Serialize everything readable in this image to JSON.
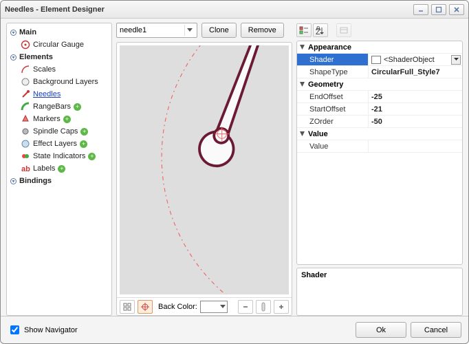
{
  "window": {
    "title": "Needles - Element Designer"
  },
  "sidebar": {
    "groups": [
      {
        "label": "Main"
      },
      {
        "label": "Elements"
      },
      {
        "label": "Bindings"
      }
    ],
    "main_items": [
      {
        "label": "Circular Gauge"
      }
    ],
    "elements_items": [
      {
        "label": "Scales"
      },
      {
        "label": "Background Layers"
      },
      {
        "label": "Needles"
      },
      {
        "label": "RangeBars"
      },
      {
        "label": "Markers"
      },
      {
        "label": "Spindle Caps"
      },
      {
        "label": "Effect Layers"
      },
      {
        "label": "State Indicators"
      },
      {
        "label": "Labels"
      }
    ]
  },
  "center": {
    "selected_needle": "needle1",
    "clone_label": "Clone",
    "remove_label": "Remove",
    "backcolor_label": "Back Color:",
    "backcolor_value": "#FFFFFF"
  },
  "propgrid": {
    "categories": [
      {
        "name": "Appearance",
        "props": [
          {
            "name": "Shader",
            "value": "<ShaderObject",
            "selected": true,
            "swatch": true,
            "dropdown": true
          },
          {
            "name": "ShapeType",
            "value": "CircularFull_Style7"
          }
        ]
      },
      {
        "name": "Geometry",
        "props": [
          {
            "name": "EndOffset",
            "value": "-25"
          },
          {
            "name": "StartOffset",
            "value": "-21"
          },
          {
            "name": "ZOrder",
            "value": "-50"
          }
        ]
      },
      {
        "name": "Value",
        "props": [
          {
            "name": "Value",
            "value": ""
          }
        ]
      }
    ],
    "desc_title": "Shader"
  },
  "footer": {
    "show_navigator_label": "Show Navigator",
    "show_navigator_checked": true,
    "ok_label": "Ok",
    "cancel_label": "Cancel"
  }
}
